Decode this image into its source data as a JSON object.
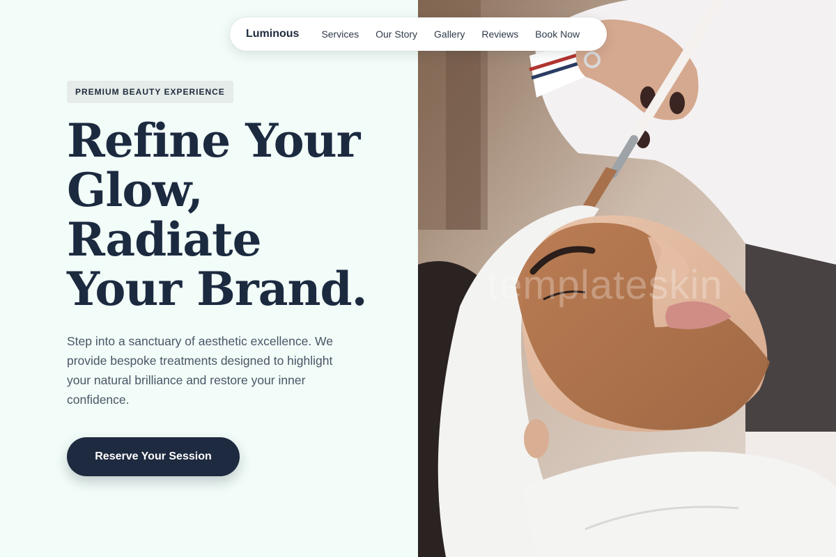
{
  "nav": {
    "brand": "Luminous",
    "links": [
      "Services",
      "Our Story",
      "Gallery",
      "Reviews",
      "Book Now"
    ]
  },
  "hero": {
    "badge": "PREMIUM BEAUTY EXPERIENCE",
    "headline_lines": [
      "Refine Your",
      "Glow,",
      "Radiate",
      "Your Brand."
    ],
    "description": "Step into a sanctuary of aesthetic excellence. We provide bespoke treatments designed to highlight your natural brilliance and restore your inner confidence.",
    "cta_label": "Reserve Your Session"
  },
  "image": {
    "watermark": "templateskin"
  },
  "colors": {
    "background": "#f2fcf8",
    "primary_dark": "#1e2a3f",
    "text_muted": "#4a5566"
  }
}
